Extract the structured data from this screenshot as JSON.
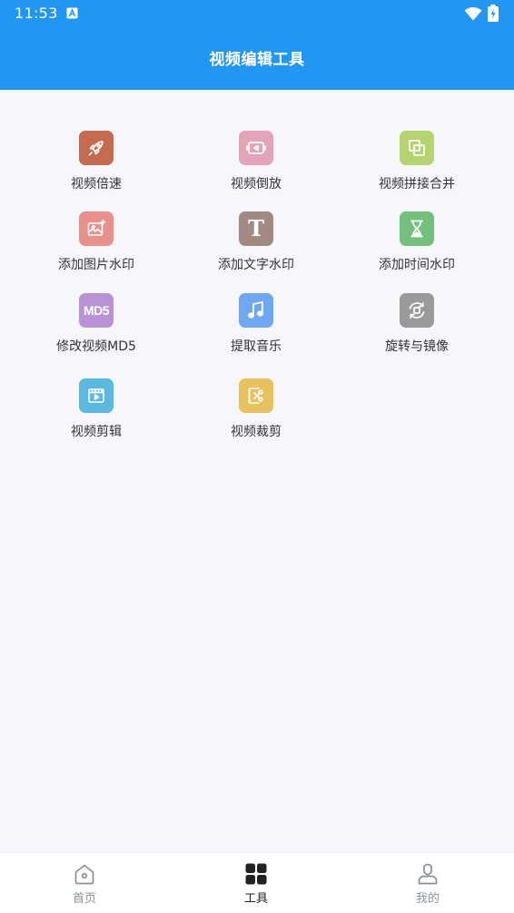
{
  "status_bar": {
    "time": "11:53"
  },
  "header": {
    "title": "视频编辑工具"
  },
  "tools": [
    {
      "label": "视频倍速",
      "icon": "rocket-icon",
      "color": "#c56b4f"
    },
    {
      "label": "视频倒放",
      "icon": "rewind-video-icon",
      "color": "#e3a4b8"
    },
    {
      "label": "视频拼接合并",
      "icon": "merge-icon",
      "color": "#b5d46f"
    },
    {
      "label": "添加图片水印",
      "icon": "image-icon",
      "color": "#e8908a"
    },
    {
      "label": "添加文字水印",
      "icon": "text-icon",
      "icon_text": "T",
      "color": "#a08a82"
    },
    {
      "label": "添加时间水印",
      "icon": "hourglass-icon",
      "color": "#72c07b"
    },
    {
      "label": "修改视频MD5",
      "icon": "md5-icon",
      "icon_text": "MD5",
      "color": "#b894d6"
    },
    {
      "label": "提取音乐",
      "icon": "music-icon",
      "color": "#6ea8f0"
    },
    {
      "label": "旋转与镜像",
      "icon": "rotate-icon",
      "color": "#9a9a9a"
    },
    {
      "label": "视频剪辑",
      "icon": "film-icon",
      "color": "#5bb9e0"
    },
    {
      "label": "视频裁剪",
      "icon": "crop-cut-icon",
      "color": "#e8c25c"
    }
  ],
  "bottom_nav": [
    {
      "label": "首页",
      "icon": "home-icon",
      "active": false
    },
    {
      "label": "工具",
      "icon": "grid-icon",
      "active": true
    },
    {
      "label": "我的",
      "icon": "user-icon",
      "active": false
    }
  ],
  "colors": {
    "primary": "#2196f3",
    "background": "#f5f7fb"
  }
}
